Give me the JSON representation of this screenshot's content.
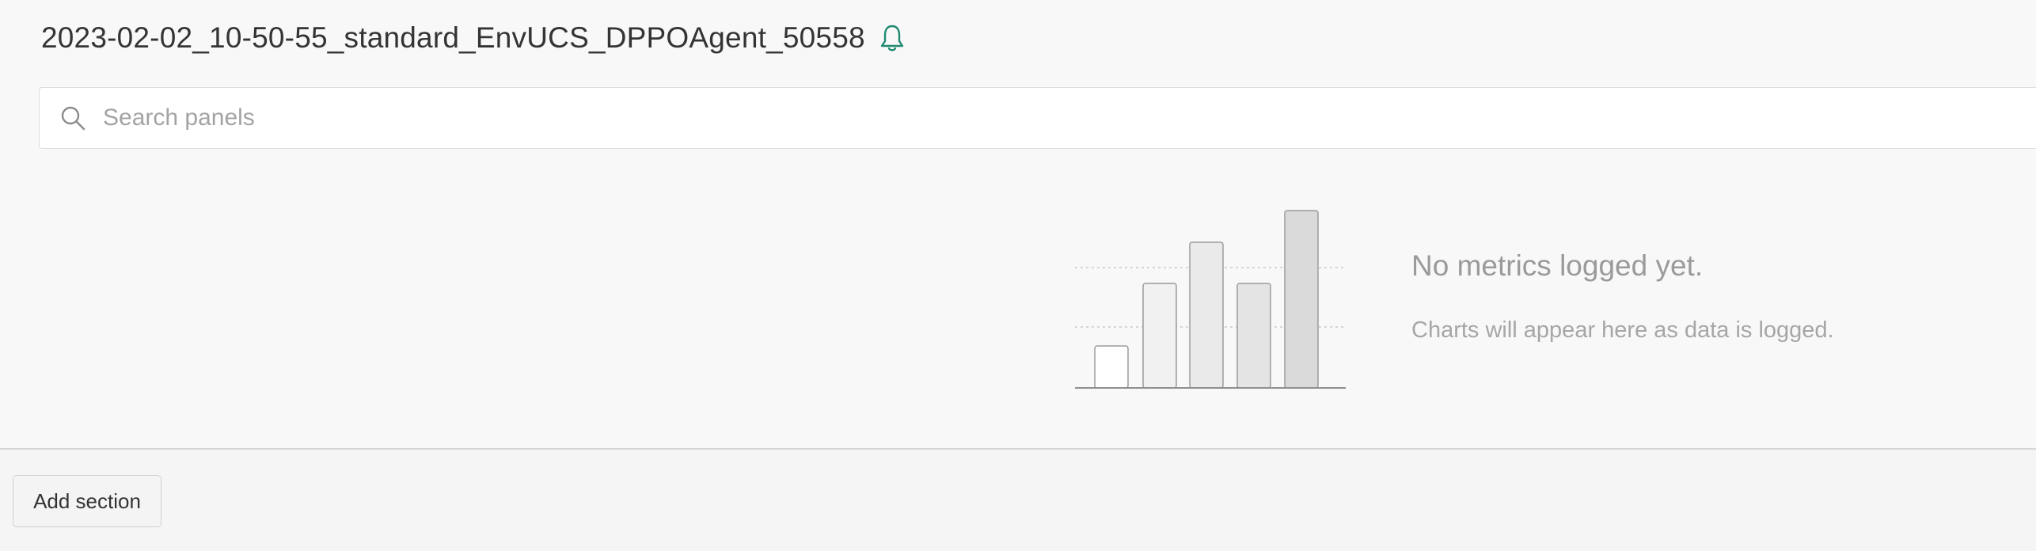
{
  "run": {
    "title": "2023-02-02_10-50-55_standard_EnvUCS_DPPOAgent_50558",
    "alert_icon": "bell-icon",
    "alert_color": "#1f8a70"
  },
  "search": {
    "placeholder": "Search panels",
    "value": "",
    "icon": "search-icon"
  },
  "empty_state": {
    "heading": "No metrics logged yet.",
    "subtext": "Charts will appear here as data is logged.",
    "illustration": "bar-chart-placeholder-icon"
  },
  "footer": {
    "add_section_label": "Add section"
  }
}
